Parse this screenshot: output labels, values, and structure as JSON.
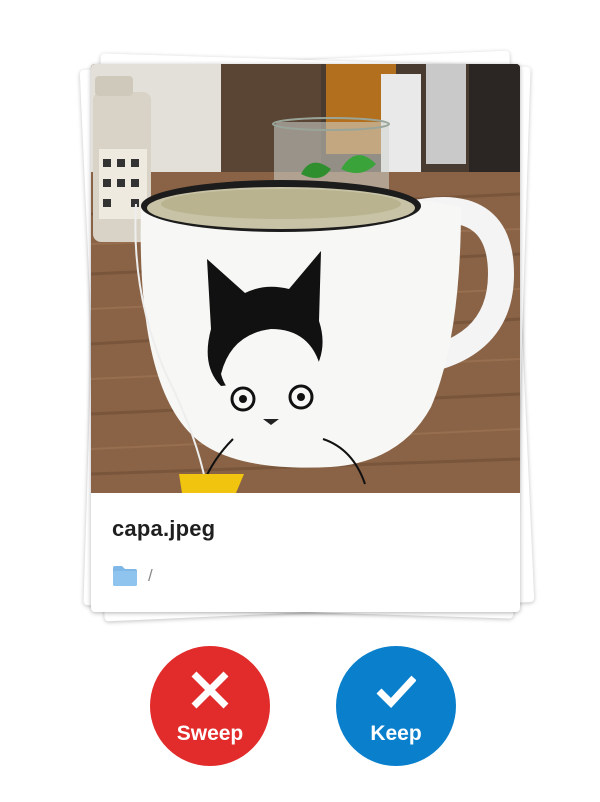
{
  "photo": {
    "description_icon": "cat-mug-photo"
  },
  "file": {
    "name": "capa.jpeg",
    "path": "/",
    "folder_icon": "folder-icon",
    "folder_color": "#7fb8e6"
  },
  "actions": {
    "sweep": {
      "label": "Sweep",
      "icon": "close-icon",
      "color": "#e22b2b"
    },
    "keep": {
      "label": "Keep",
      "icon": "check-icon",
      "color": "#0a80cc"
    }
  }
}
